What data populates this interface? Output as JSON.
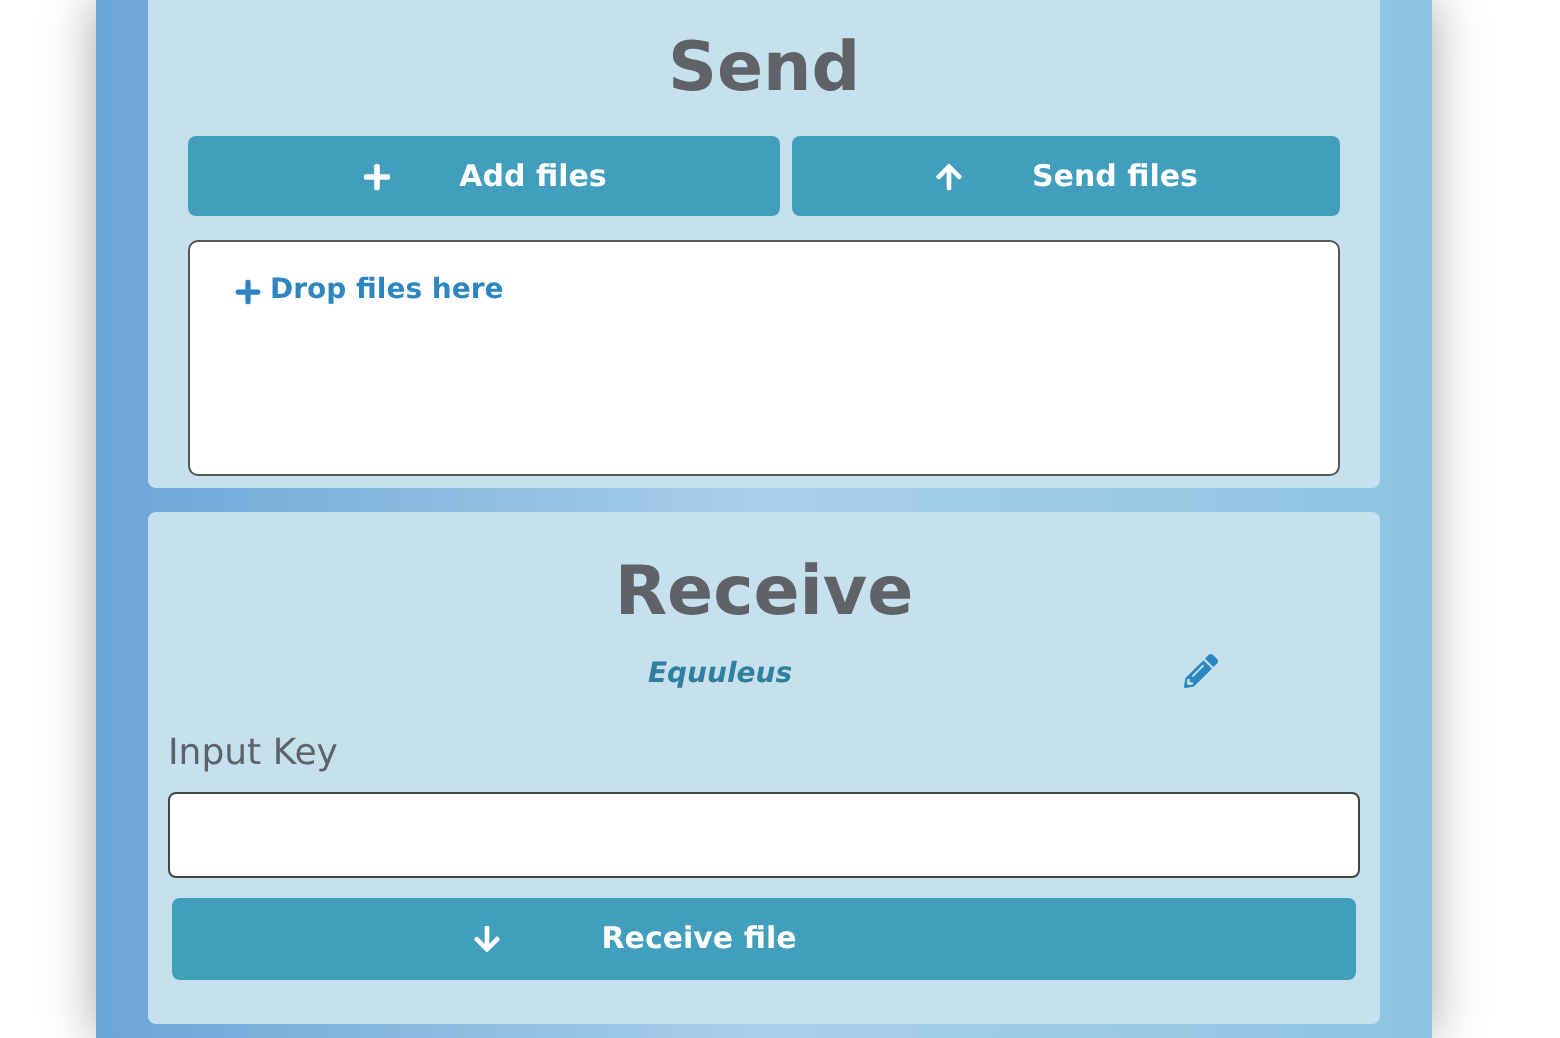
{
  "send": {
    "title": "Send",
    "buttons": [
      {
        "kind": "add",
        "label": "Add files"
      },
      {
        "kind": "upload",
        "label": "Send files"
      }
    ],
    "dropzone": {
      "label": "Drop files here"
    }
  },
  "receive": {
    "title": "Receive",
    "name": "Equuleus",
    "key_label": "Input Key",
    "button": {
      "label": "Receive file"
    }
  }
}
